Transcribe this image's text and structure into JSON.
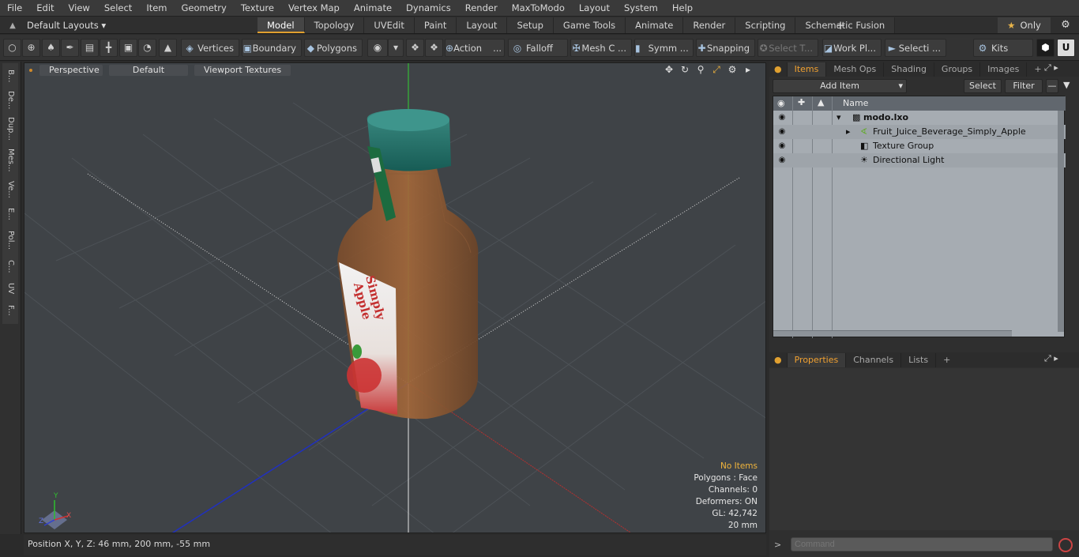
{
  "menu": [
    "File",
    "Edit",
    "View",
    "Select",
    "Item",
    "Geometry",
    "Texture",
    "Vertex Map",
    "Animate",
    "Dynamics",
    "Render",
    "MaxToModo",
    "Layout",
    "System",
    "Help"
  ],
  "layouts": {
    "label": "Default Layouts ▾"
  },
  "mode_tabs": [
    "Model",
    "Topology",
    "UVEdit",
    "Paint",
    "Layout",
    "Setup",
    "Game Tools",
    "Animate",
    "Render",
    "Scripting",
    "Schematic Fusion"
  ],
  "active_mode": "Model",
  "only_label": "Only",
  "toolbar": {
    "vertices": "Vertices",
    "boundary": "Boundary",
    "polygons": "Polygons",
    "action": "Action",
    "action_more": "...",
    "falloff": "Falloff",
    "mesh": "Mesh C ...",
    "symm": "Symm ...",
    "snapping": "Snapping",
    "select_t": "Select T...",
    "workplane": "Work Pl...",
    "selecti": "Selecti ...",
    "kits": "Kits"
  },
  "left_tabs": [
    "B...",
    "De...",
    "Dup...",
    "Mes...",
    "Ve...",
    "E...",
    "Pol...",
    "C...",
    "UV",
    "F..."
  ],
  "viewport": {
    "view": "Perspective",
    "shading": "Default",
    "textures": "Viewport Textures",
    "label_line1": "Simply",
    "label_line2": "Apple",
    "info": {
      "no_items": "No Items",
      "polygons": "Polygons : Face",
      "channels": "Channels: 0",
      "deformers": "Deformers: ON",
      "gl": "GL: 42,742",
      "scale": "20 mm"
    },
    "axis": {
      "x": "X",
      "y": "Y",
      "z": "Z"
    }
  },
  "status": {
    "position": "Position X, Y, Z:   46 mm, 200 mm, -55 mm"
  },
  "items_panel": {
    "tabs": [
      "Items",
      "Mesh Ops",
      "Shading",
      "Groups",
      "Images"
    ],
    "add_item": "Add Item",
    "select": "Select",
    "filter": "Filter",
    "col_name": "Name",
    "rows": [
      {
        "name": "modo.lxo"
      },
      {
        "name": "Fruit_Juice_Beverage_Simply_Apple"
      },
      {
        "name": "Texture Group"
      },
      {
        "name": "Directional Light"
      }
    ]
  },
  "props_panel": {
    "tabs": [
      "Properties",
      "Channels",
      "Lists"
    ],
    "command_placeholder": "Command"
  },
  "colors": {
    "accent": "#e0a030",
    "viewport_bg": "#3f4347",
    "grid_x": "#b03030",
    "grid_y": "#30c030",
    "grid_z": "#2020b0"
  }
}
